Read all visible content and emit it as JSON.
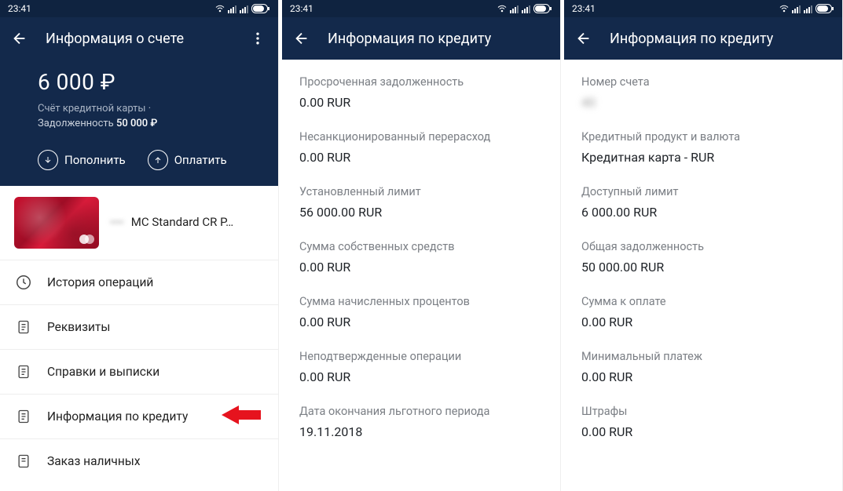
{
  "status": {
    "time": "23:41"
  },
  "screen1": {
    "header": {
      "title": "Информация о счете"
    },
    "hero": {
      "balance": "6 000 ₽",
      "subtitle": "Счёт кредитной карты ·",
      "debt_label": "Задолженность",
      "debt_value": "50 000 ₽"
    },
    "actions": {
      "deposit": "Пополнить",
      "pay": "Оплатить"
    },
    "card": {
      "masked_number": "•••• ",
      "name": "MC Standard CR P…",
      "subtitle": " "
    },
    "menu": [
      {
        "key": "history",
        "label": "История операций"
      },
      {
        "key": "details",
        "label": "Реквизиты"
      },
      {
        "key": "statements",
        "label": "Справки и выписки"
      },
      {
        "key": "credit-info",
        "label": "Информация по кредиту"
      },
      {
        "key": "cash-order",
        "label": "Заказ наличных"
      }
    ]
  },
  "screen2": {
    "header": {
      "title": "Информация по кредиту"
    },
    "rows": [
      {
        "label": "Просроченная задолженность",
        "value": "0.00 RUR"
      },
      {
        "label": "Несанкционированный перерасход",
        "value": "0.00 RUR"
      },
      {
        "label": "Установленный лимит",
        "value": "56 000.00 RUR"
      },
      {
        "label": "Сумма собственных средств",
        "value": "0.00 RUR"
      },
      {
        "label": "Сумма начисленных процентов",
        "value": "0.00 RUR"
      },
      {
        "label": "Неподтвержденные операции",
        "value": "0.00 RUR"
      },
      {
        "label": "Дата окончания льготного периода",
        "value": "19.11.2018"
      }
    ]
  },
  "screen3": {
    "header": {
      "title": "Информация по кредиту"
    },
    "rows": [
      {
        "label": "Номер счета",
        "value": "40",
        "blur": true
      },
      {
        "label": "Кредитный продукт и валюта",
        "value": "Кредитная карта - RUR"
      },
      {
        "label": "Доступный лимит",
        "value": "6 000.00 RUR"
      },
      {
        "label": "Общая задолженность",
        "value": "50 000.00 RUR"
      },
      {
        "label": "Сумма к оплате",
        "value": "0.00 RUR"
      },
      {
        "label": "Минимальный платеж",
        "value": "0.00 RUR"
      },
      {
        "label": "Штрафы",
        "value": "0.00 RUR"
      }
    ]
  }
}
